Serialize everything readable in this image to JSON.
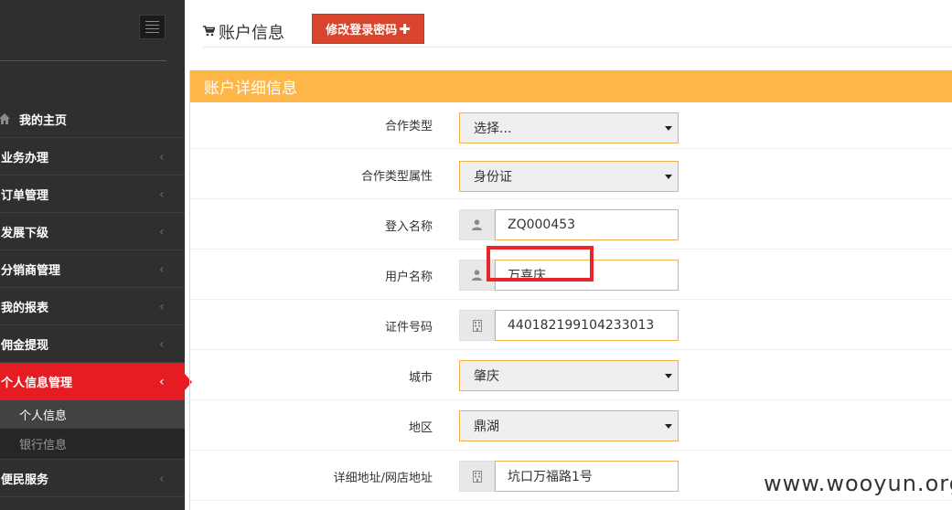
{
  "sidebar": {
    "items": [
      {
        "label": "我的主页",
        "icon": "home-icon"
      },
      {
        "label": "业务办理"
      },
      {
        "label": "订单管理"
      },
      {
        "label": "发展下级"
      },
      {
        "label": "分销商管理"
      },
      {
        "label": "我的报表"
      },
      {
        "label": "佣金提现"
      },
      {
        "label": "个人信息管理",
        "active": true
      }
    ],
    "subitems": [
      {
        "label": "个人信息",
        "current": true
      },
      {
        "label": "银行信息"
      }
    ],
    "after": [
      {
        "label": "便民服务"
      }
    ],
    "chevron": "‹"
  },
  "header": {
    "title": "账户信息",
    "change_password_button": "修改登录密码",
    "plus": "✚"
  },
  "panel": {
    "title": "账户详细信息",
    "fields": {
      "cooperation_type": {
        "label": "合作类型",
        "value": "选择..."
      },
      "cooperation_attr": {
        "label": "合作类型属性",
        "value": "身份证"
      },
      "login_name": {
        "label": "登入名称",
        "value": "ZQ000453"
      },
      "user_name": {
        "label": "用户名称",
        "value": "万喜庆"
      },
      "id_number": {
        "label": "证件号码",
        "value": "440182199104233013"
      },
      "city": {
        "label": "城市",
        "value": "肇庆"
      },
      "district": {
        "label": "地区",
        "value": "鼎湖"
      },
      "address": {
        "label": "详细地址/网店地址",
        "value": "坑口万福路1号"
      }
    }
  },
  "watermark": "www.wooyun.org",
  "colors": {
    "sidebar_bg": "#2f2f2f",
    "active_red": "#e51d23",
    "panel_heading": "#ffb648",
    "button_red": "#d9442d",
    "input_border": "#f0b04a",
    "highlight": "#e8252b"
  }
}
